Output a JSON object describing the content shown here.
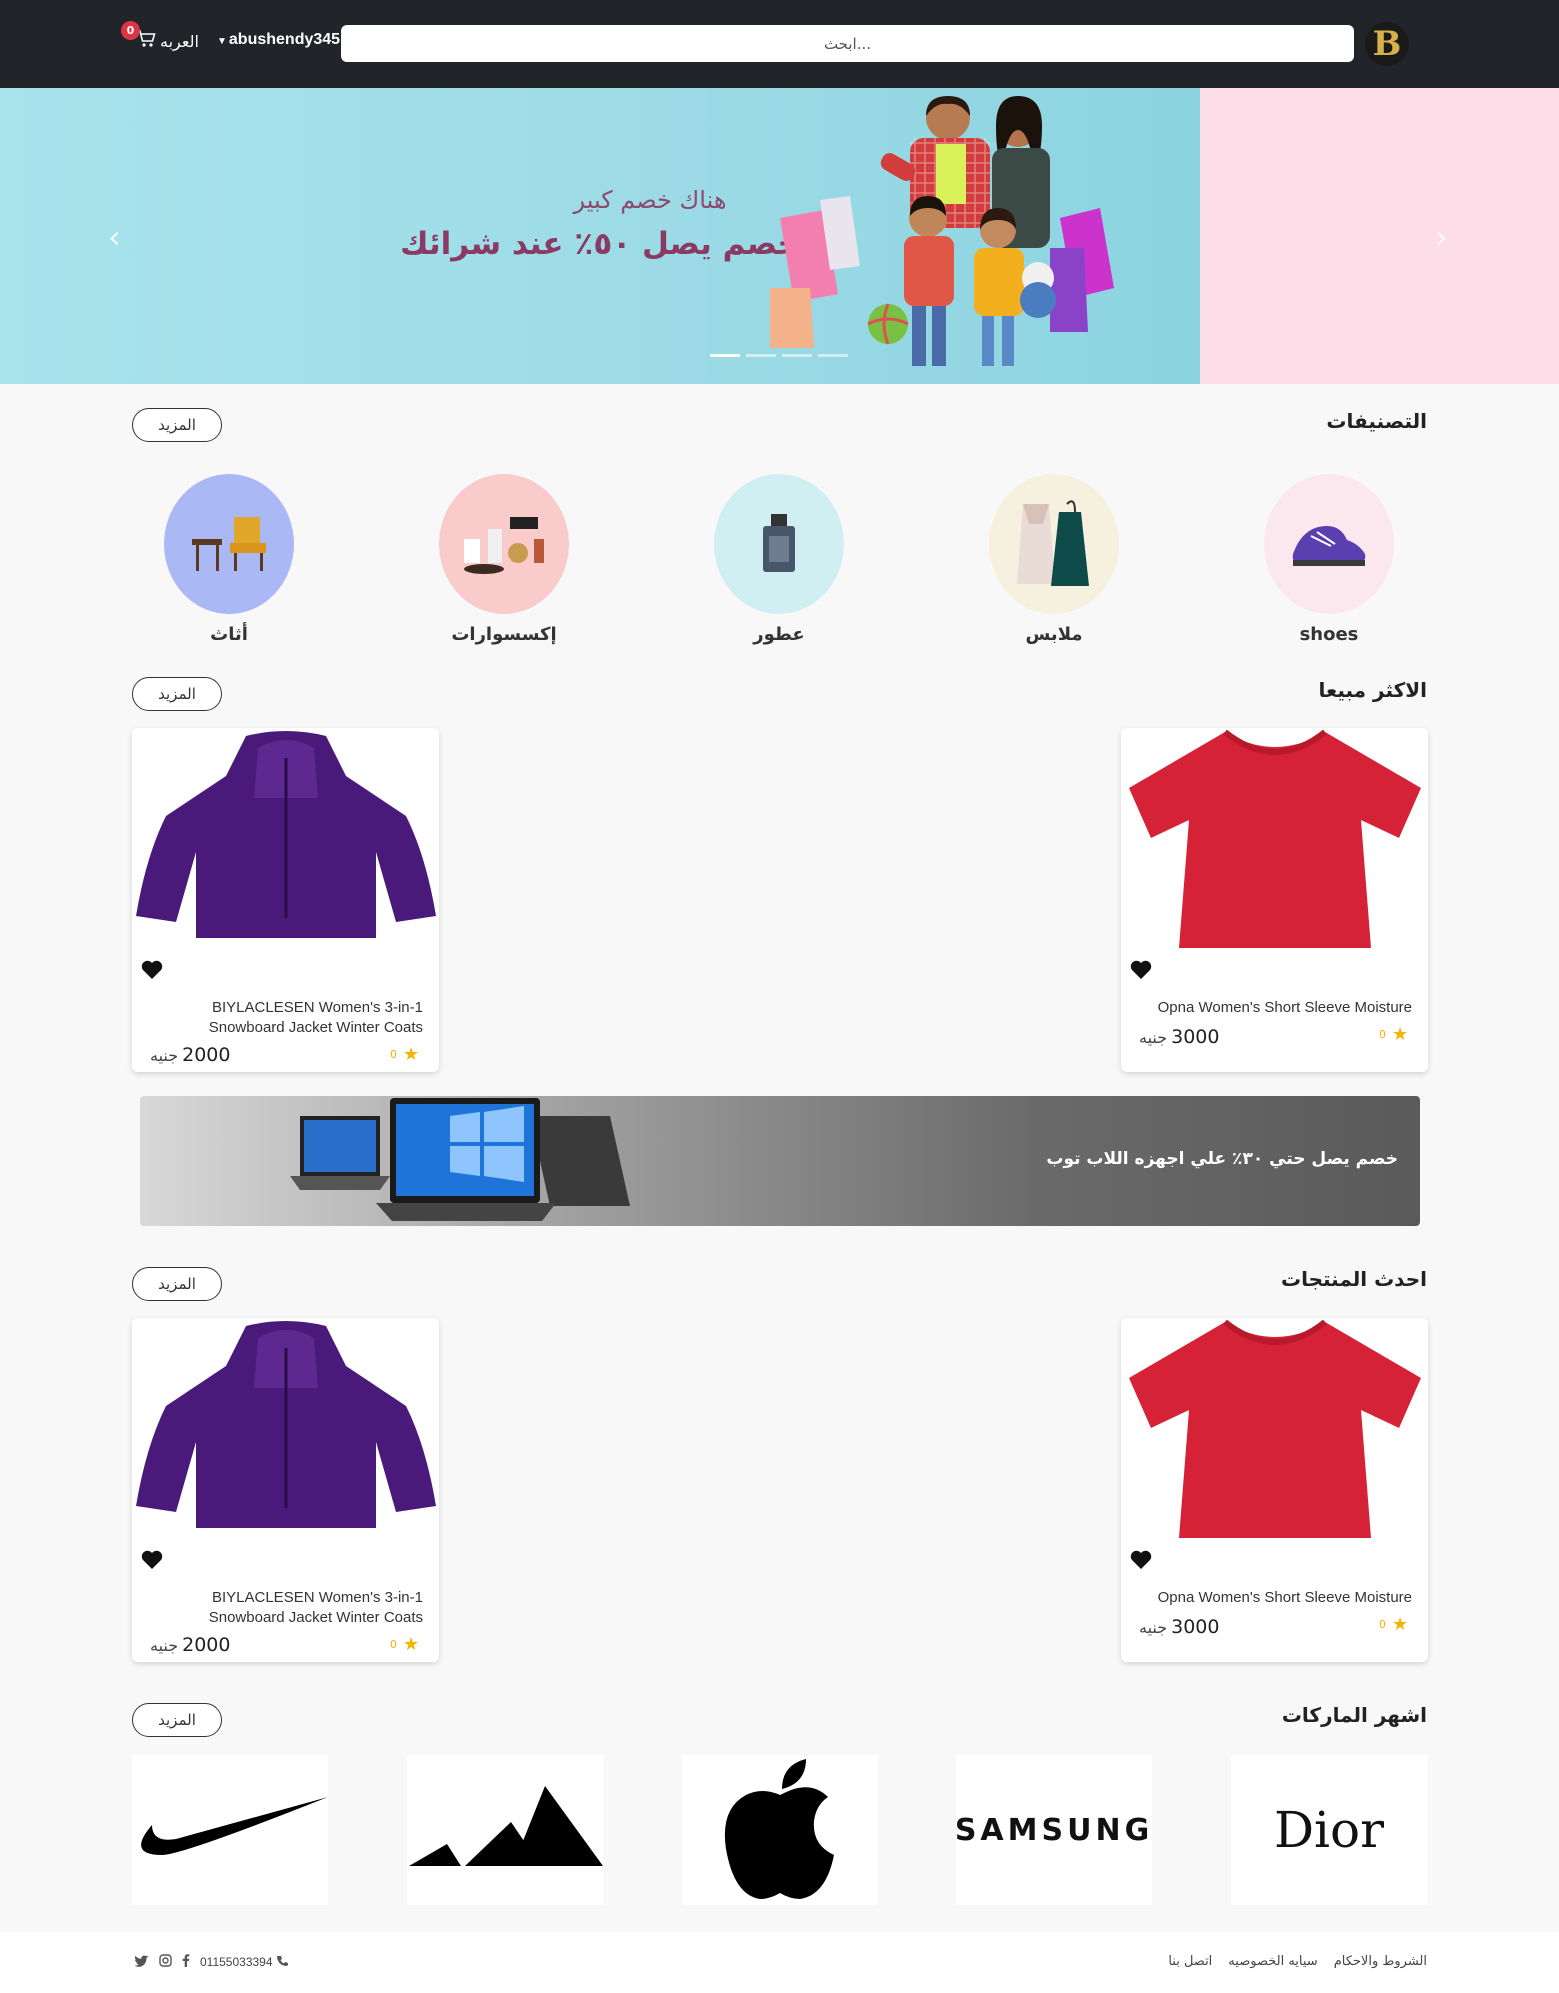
{
  "navbar": {
    "search_placeholder": "ابحث...",
    "username": "abushendy345",
    "cart_label": "العربه",
    "cart_count": "0"
  },
  "hero": {
    "subtitle": "هناك خصم كبير",
    "title": "خصم يصل ٥٠٪ عند شرائك",
    "slide_count": 4,
    "active_slide": 1
  },
  "categories": {
    "title": "التصنيفات",
    "more_label": "المزيد",
    "items": [
      {
        "label": "shoes",
        "color": "#fbe8ef"
      },
      {
        "label": "ملابس",
        "color": "#f6f0de"
      },
      {
        "label": "عطور",
        "color": "#cfeff3"
      },
      {
        "label": "إكسسوارات",
        "color": "#f9cbcb"
      },
      {
        "label": "أثاث",
        "color": "#aab8f5"
      }
    ]
  },
  "best_sellers": {
    "title": "الاكثر مبيعا",
    "more_label": "المزيد",
    "products": [
      {
        "name": "Opna Women's Short Sleeve Moisture",
        "rating": "0",
        "price": "3000",
        "currency": "جنيه"
      },
      {
        "name": "BIYLACLESEN Women's 3-in-1 Snowboard Jacket Winter Coats",
        "rating": "0",
        "price": "2000",
        "currency": "جنيه"
      }
    ]
  },
  "promo": {
    "text": "خصم يصل حتي ٣٠٪ علي اجهزه اللاب توب"
  },
  "latest": {
    "title": "احدث المنتجات",
    "more_label": "المزيد",
    "products": [
      {
        "name": "Opna Women's Short Sleeve Moisture",
        "rating": "0",
        "price": "3000",
        "currency": "جنيه"
      },
      {
        "name": "BIYLACLESEN Women's 3-in-1 Snowboard Jacket Winter Coats",
        "rating": "0",
        "price": "2000",
        "currency": "جنيه"
      }
    ]
  },
  "brands": {
    "title": "اشهر الماركات",
    "more_label": "المزيد",
    "items": [
      "Dior",
      "SAMSUNG",
      "apple",
      "adidas",
      "nike"
    ]
  },
  "footer": {
    "links": [
      "الشروط والاحكام",
      "سيايه الخصوصيه",
      "اتصل بنا"
    ],
    "phone": "01155033394",
    "social": [
      "facebook-icon",
      "instagram-icon",
      "twitter-icon"
    ]
  }
}
